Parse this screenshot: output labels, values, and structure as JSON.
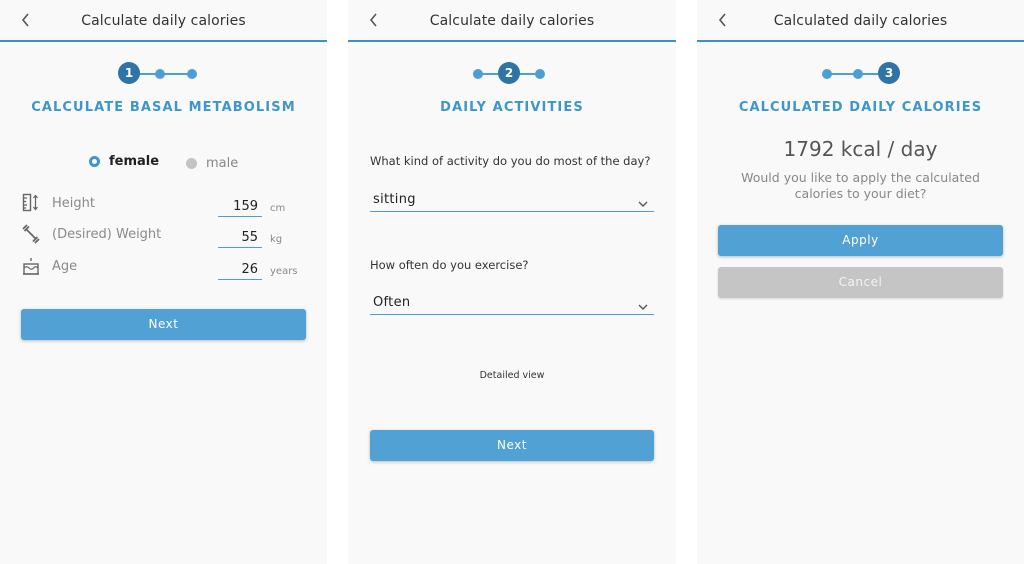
{
  "colors": {
    "accent": "#4c9fd3",
    "step_active": "#2e74a6",
    "section_title": "#3d96cc",
    "button_primary": "#51a1d4",
    "button_disabled": "#c5c5c5",
    "screen_bg": "#f9f9f9"
  },
  "screens": [
    {
      "appbar": {
        "back_icon": "chevron-left-icon",
        "title": "Calculate daily calories"
      },
      "stepper": {
        "active_step": 1,
        "active_label": "1",
        "total_steps": 3
      },
      "section_title": "CALCULATE BASAL METABOLISM",
      "gender": {
        "selected": "female",
        "options": [
          {
            "label": "female"
          },
          {
            "label": "male"
          }
        ]
      },
      "fields": [
        {
          "icon": "ruler-height-icon",
          "label": "Height",
          "value": "159",
          "unit": "cm"
        },
        {
          "icon": "dumbbell-icon",
          "label": "(Desired) Weight",
          "value": "55",
          "unit": "kg"
        },
        {
          "icon": "birthday-cake-icon",
          "label": "Age",
          "value": "26",
          "unit": "years"
        }
      ],
      "next_label": "Next"
    },
    {
      "appbar": {
        "back_icon": "chevron-left-icon",
        "title": "Calculate daily calories"
      },
      "stepper": {
        "active_step": 2,
        "active_label": "2",
        "total_steps": 3
      },
      "section_title": "DAILY ACTIVITIES",
      "questions": [
        {
          "label": "What kind of activity do you do most of the day?",
          "selected": "sitting"
        },
        {
          "label": "How often do you exercise?",
          "selected": "Often"
        }
      ],
      "detailed_view_label": "Detailed view",
      "next_label": "Next"
    },
    {
      "appbar": {
        "back_icon": "chevron-left-icon",
        "title": "Calculated daily calories"
      },
      "stepper": {
        "active_step": 3,
        "active_label": "3",
        "total_steps": 3
      },
      "section_title": "CALCULATED DAILY CALORIES",
      "result": "1792 kcal / day",
      "prompt": "Would you like to apply the calculated calories to your diet?",
      "apply_label": "Apply",
      "cancel_label": "Cancel"
    }
  ]
}
